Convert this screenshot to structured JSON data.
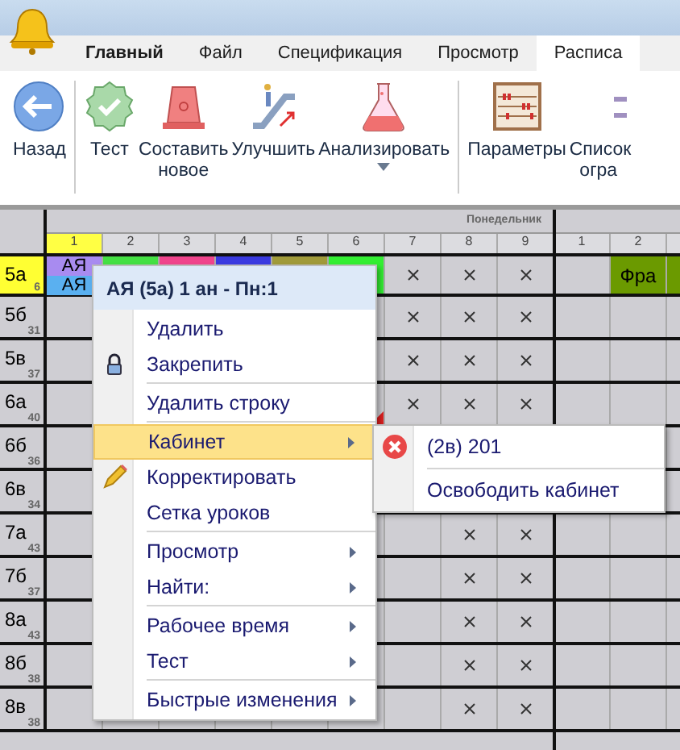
{
  "tabs": [
    {
      "label": "Главный",
      "kind": "main",
      "selected": false
    },
    {
      "label": "Файл",
      "kind": "tab",
      "selected": false
    },
    {
      "label": "Спецификация",
      "kind": "tab",
      "selected": false
    },
    {
      "label": "Просмотр",
      "kind": "tab",
      "selected": false
    },
    {
      "label": "Расписа",
      "kind": "tab",
      "selected": true
    }
  ],
  "ribbon": {
    "groups": [
      [
        {
          "label": "Назад",
          "dropdown": false
        }
      ],
      [
        {
          "label": "Тест",
          "dropdown": false
        },
        {
          "label": "Составить новое",
          "dropdown": false
        },
        {
          "label": "Улучшить",
          "dropdown": false
        },
        {
          "label": "Анализировать",
          "dropdown": true
        }
      ],
      [
        {
          "label": "Параметры",
          "dropdown": false
        },
        {
          "label": "Список огра",
          "dropdown": false
        }
      ]
    ]
  },
  "timetable": {
    "days": [
      {
        "name": "Понедельник",
        "periods": [
          {
            "label": "1",
            "selected": true
          },
          {
            "label": "2",
            "selected": false
          },
          {
            "label": "3",
            "selected": false
          },
          {
            "label": "4",
            "selected": false
          },
          {
            "label": "5",
            "selected": false
          },
          {
            "label": "6",
            "selected": false
          },
          {
            "label": "7",
            "selected": false
          },
          {
            "label": "8",
            "selected": false
          },
          {
            "label": "9",
            "selected": false
          }
        ]
      },
      {
        "periods": [
          {
            "label": "1",
            "selected": false
          },
          {
            "label": "2",
            "selected": false
          }
        ]
      }
    ],
    "rows": [
      {
        "name": "5а",
        "count": "6",
        "selected": true,
        "cells": [
          {
            "kind": "split",
            "parts": [
              {
                "text": "АЯ",
                "color": "#a88bf0"
              },
              {
                "text": "АЯ",
                "color": "#5ab0f0"
              }
            ]
          },
          {
            "kind": "lesson",
            "color": "#44e044"
          },
          {
            "kind": "lesson",
            "color": "#f0448c"
          },
          {
            "kind": "lesson",
            "color": "#3a3ae0"
          },
          {
            "kind": "lesson",
            "color": "#a09a3a"
          },
          {
            "kind": "lesson",
            "color": "#33ee33"
          },
          {
            "kind": "blocked"
          },
          {
            "kind": "blocked"
          },
          {
            "kind": "blocked"
          },
          {
            "kind": "empty"
          },
          {
            "kind": "lesson",
            "text": "Фра",
            "color": "#6b9a00"
          },
          {
            "kind": "lesson",
            "color": "#6b9a00"
          }
        ]
      },
      {
        "name": "5б",
        "count": "31",
        "selected": false,
        "cells": [
          {
            "kind": "empty"
          },
          {
            "kind": "empty"
          },
          {
            "kind": "empty"
          },
          {
            "kind": "empty"
          },
          {
            "kind": "empty"
          },
          {
            "kind": "empty"
          },
          {
            "kind": "blocked"
          },
          {
            "kind": "blocked"
          },
          {
            "kind": "blocked"
          },
          {
            "kind": "empty"
          },
          {
            "kind": "empty"
          },
          {
            "kind": "empty"
          }
        ]
      },
      {
        "name": "5в",
        "count": "37",
        "selected": false,
        "cells": [
          {
            "kind": "empty"
          },
          {
            "kind": "empty"
          },
          {
            "kind": "empty"
          },
          {
            "kind": "empty"
          },
          {
            "kind": "empty"
          },
          {
            "kind": "empty"
          },
          {
            "kind": "blocked"
          },
          {
            "kind": "blocked"
          },
          {
            "kind": "blocked"
          },
          {
            "kind": "empty"
          },
          {
            "kind": "empty"
          },
          {
            "kind": "empty"
          }
        ]
      },
      {
        "name": "6а",
        "count": "40",
        "selected": false,
        "cells": [
          {
            "kind": "empty"
          },
          {
            "kind": "empty"
          },
          {
            "kind": "empty"
          },
          {
            "kind": "empty"
          },
          {
            "kind": "empty"
          },
          {
            "kind": "marked"
          },
          {
            "kind": "blocked"
          },
          {
            "kind": "blocked"
          },
          {
            "kind": "blocked"
          },
          {
            "kind": "empty"
          },
          {
            "kind": "empty"
          },
          {
            "kind": "empty"
          }
        ]
      },
      {
        "name": "6б",
        "count": "36",
        "selected": false,
        "cells": [
          {
            "kind": "empty"
          },
          {
            "kind": "empty"
          },
          {
            "kind": "empty"
          },
          {
            "kind": "empty"
          },
          {
            "kind": "empty"
          },
          {
            "kind": "empty"
          },
          {
            "kind": "empty"
          },
          {
            "kind": "empty"
          },
          {
            "kind": "empty"
          },
          {
            "kind": "empty"
          },
          {
            "kind": "empty"
          },
          {
            "kind": "empty"
          }
        ]
      },
      {
        "name": "6в",
        "count": "34",
        "selected": false,
        "cells": [
          {
            "kind": "empty"
          },
          {
            "kind": "empty"
          },
          {
            "kind": "empty"
          },
          {
            "kind": "empty"
          },
          {
            "kind": "empty"
          },
          {
            "kind": "empty"
          },
          {
            "kind": "empty"
          },
          {
            "kind": "empty"
          },
          {
            "kind": "empty"
          },
          {
            "kind": "empty"
          },
          {
            "kind": "empty"
          },
          {
            "kind": "empty"
          }
        ]
      },
      {
        "name": "7а",
        "count": "43",
        "selected": false,
        "cells": [
          {
            "kind": "empty"
          },
          {
            "kind": "empty"
          },
          {
            "kind": "empty"
          },
          {
            "kind": "empty"
          },
          {
            "kind": "empty"
          },
          {
            "kind": "empty"
          },
          {
            "kind": "empty"
          },
          {
            "kind": "blocked"
          },
          {
            "kind": "blocked"
          },
          {
            "kind": "empty"
          },
          {
            "kind": "empty"
          },
          {
            "kind": "empty"
          }
        ]
      },
      {
        "name": "7б",
        "count": "37",
        "selected": false,
        "cells": [
          {
            "kind": "empty"
          },
          {
            "kind": "empty"
          },
          {
            "kind": "empty"
          },
          {
            "kind": "empty"
          },
          {
            "kind": "empty"
          },
          {
            "kind": "empty"
          },
          {
            "kind": "empty"
          },
          {
            "kind": "blocked"
          },
          {
            "kind": "blocked"
          },
          {
            "kind": "empty"
          },
          {
            "kind": "empty"
          },
          {
            "kind": "empty"
          }
        ]
      },
      {
        "name": "8а",
        "count": "43",
        "selected": false,
        "cells": [
          {
            "kind": "empty"
          },
          {
            "kind": "empty"
          },
          {
            "kind": "empty"
          },
          {
            "kind": "empty"
          },
          {
            "kind": "empty"
          },
          {
            "kind": "empty"
          },
          {
            "kind": "empty"
          },
          {
            "kind": "blocked"
          },
          {
            "kind": "blocked"
          },
          {
            "kind": "empty"
          },
          {
            "kind": "empty"
          },
          {
            "kind": "empty"
          }
        ]
      },
      {
        "name": "8б",
        "count": "38",
        "selected": false,
        "cells": [
          {
            "kind": "empty"
          },
          {
            "kind": "empty"
          },
          {
            "kind": "empty"
          },
          {
            "kind": "empty"
          },
          {
            "kind": "empty"
          },
          {
            "kind": "empty"
          },
          {
            "kind": "empty"
          },
          {
            "kind": "blocked"
          },
          {
            "kind": "blocked"
          },
          {
            "kind": "empty"
          },
          {
            "kind": "empty"
          },
          {
            "kind": "empty"
          }
        ]
      },
      {
        "name": "8в",
        "count": "38",
        "selected": false,
        "cells": [
          {
            "kind": "empty"
          },
          {
            "kind": "empty"
          },
          {
            "kind": "empty"
          },
          {
            "kind": "empty"
          },
          {
            "kind": "empty"
          },
          {
            "kind": "empty"
          },
          {
            "kind": "empty"
          },
          {
            "kind": "blocked"
          },
          {
            "kind": "blocked"
          },
          {
            "kind": "empty"
          },
          {
            "kind": "empty"
          },
          {
            "kind": "empty"
          }
        ]
      }
    ]
  },
  "context_menu": {
    "title": "АЯ (5а) 1 ан - Пн:1",
    "items": [
      {
        "kind": "command",
        "label": "Удалить",
        "selected": false
      },
      {
        "kind": "pin",
        "label": "Закрепить",
        "selected": false
      },
      {
        "kind": "separator"
      },
      {
        "kind": "command",
        "label": "Удалить строку",
        "selected": false
      },
      {
        "kind": "separator"
      },
      {
        "kind": "submenu",
        "label": "Кабинет",
        "selected": true
      },
      {
        "kind": "edit",
        "label": "Корректировать",
        "selected": false
      },
      {
        "kind": "command",
        "label": "Сетка уроков",
        "selected": false
      },
      {
        "kind": "separator"
      },
      {
        "kind": "submenu",
        "label": "Просмотр",
        "selected": false
      },
      {
        "kind": "submenu",
        "label": "Найти:",
        "selected": false
      },
      {
        "kind": "separator"
      },
      {
        "kind": "submenu",
        "label": "Рабочее время",
        "selected": false
      },
      {
        "kind": "submenu",
        "label": "Тест",
        "selected": false
      },
      {
        "kind": "separator"
      },
      {
        "kind": "submenu",
        "label": "Быстрые изменения",
        "selected": false
      }
    ]
  },
  "submenu": {
    "items": [
      {
        "kind": "room",
        "label": "(2в) 201"
      },
      {
        "kind": "separator"
      },
      {
        "kind": "command",
        "label": "Освободить кабинет"
      }
    ]
  }
}
